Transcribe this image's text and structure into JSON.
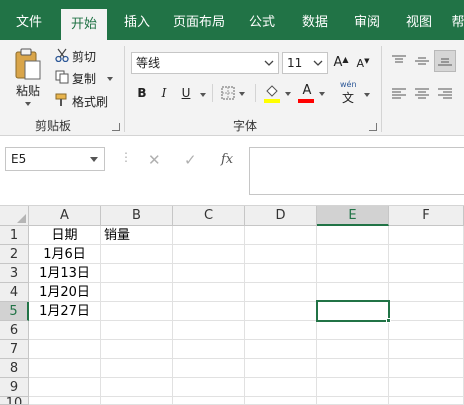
{
  "tabs": [
    {
      "label": "文件",
      "active": false
    },
    {
      "label": "开始",
      "active": true
    },
    {
      "label": "插入",
      "active": false
    },
    {
      "label": "页面布局",
      "active": false
    },
    {
      "label": "公式",
      "active": false
    },
    {
      "label": "数据",
      "active": false
    },
    {
      "label": "审阅",
      "active": false
    },
    {
      "label": "视图",
      "active": false
    },
    {
      "label": "帮",
      "active": false
    }
  ],
  "clipboard": {
    "paste_label": "粘贴",
    "cut_label": "剪切",
    "copy_label": "复制",
    "format_painter_label": "格式刷",
    "group_label": "剪贴板"
  },
  "font": {
    "name": "等线",
    "size": "11",
    "grow_label": "A",
    "shrink_label": "A",
    "bold": "B",
    "italic": "I",
    "underline": "U",
    "font_color_letter": "A",
    "phonetic_top": "wén",
    "phonetic_bottom": "文",
    "group_label": "字体",
    "highlight_color": "#ffff00",
    "font_color": "#ff0000"
  },
  "formula_bar": {
    "name_box": "E5",
    "cancel": "✕",
    "enter": "✓",
    "fx": "fx",
    "content": ""
  },
  "sheet": {
    "columns": [
      "A",
      "B",
      "C",
      "D",
      "E",
      "F"
    ],
    "selected_column": "E",
    "rows": [
      "1",
      "2",
      "3",
      "4",
      "5",
      "6",
      "7",
      "8",
      "9",
      "10"
    ],
    "selected_row": "5",
    "cells": {
      "A1": "日期",
      "B1": "销量",
      "A2": "1月6日",
      "A3": "1月13日",
      "A4": "1月20日",
      "A5": "1月27日"
    },
    "active_cell": "E5"
  },
  "colors": {
    "accent": "#217346"
  }
}
